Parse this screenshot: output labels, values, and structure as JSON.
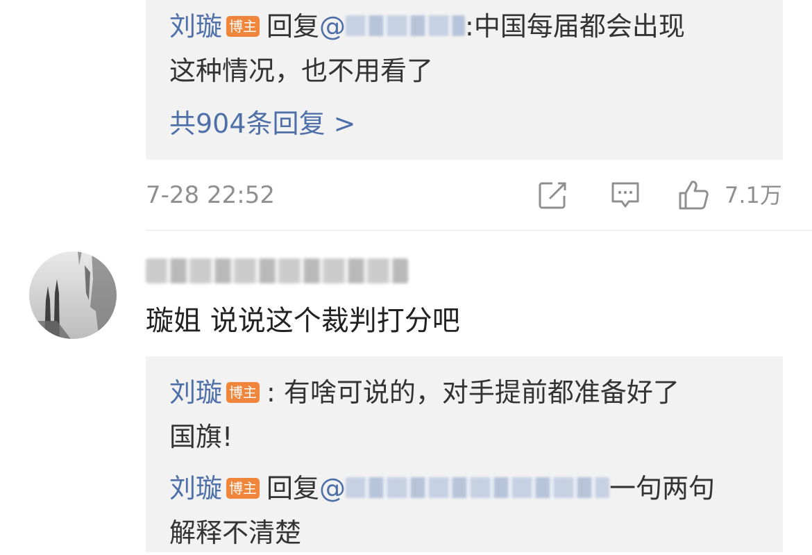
{
  "thread1": {
    "reply": {
      "author": "刘璇",
      "badge": "博主",
      "verb": "回复",
      "mention_prefix": "@",
      "text_line1": ":中国每届都会出现",
      "text_line2": "这种情况，也不用看了"
    },
    "more_replies": "共904条回复 >",
    "meta": {
      "time": "7-28 22:52",
      "likes": "7.1万",
      "icons": [
        "repost-icon",
        "comment-icon",
        "like-icon"
      ]
    }
  },
  "comment2": {
    "text": "璇姐 说说这个裁判打分吧",
    "replies": [
      {
        "author": "刘璇",
        "badge": "博主",
        "text_line1": ": 有啥可说的，对手提前都准备好了",
        "text_line2": "国旗!"
      },
      {
        "author": "刘璇",
        "badge": "博主",
        "verb": "回复",
        "mention_prefix": "@",
        "text_line1": "一句两句",
        "text_line2": "解释不清楚"
      }
    ]
  }
}
